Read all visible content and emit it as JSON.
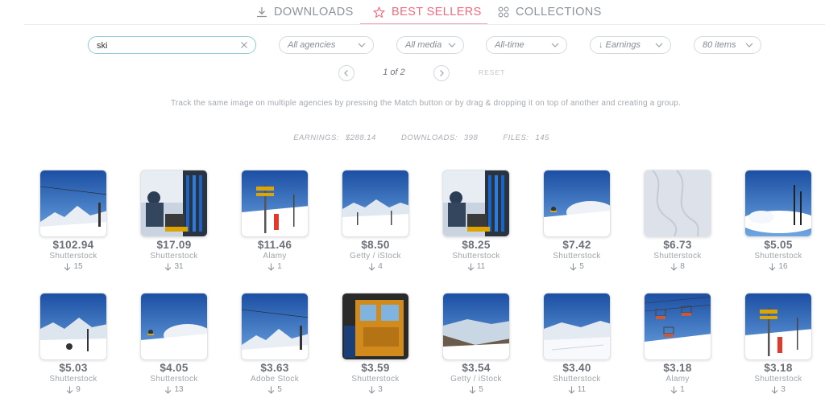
{
  "nav": {
    "tabs": [
      {
        "label": "DOWNLOADS",
        "icon": "download-icon"
      },
      {
        "label": "BEST SELLERS",
        "icon": "star-icon",
        "active": true
      },
      {
        "label": "COLLECTIONS",
        "icon": "grid-icon"
      }
    ],
    "accent_color": "#f06b7f"
  },
  "filters": {
    "search_value": "ski",
    "agencies": "All agencies",
    "media": "All media",
    "period": "All-time",
    "sort": "↓ Earnings",
    "items": "80 items"
  },
  "pagination": {
    "label": "1 of 2",
    "reset": "RESET"
  },
  "info_text": "Track the same image on multiple agencies by pressing the Match button or by drag & dropping it on top of another and creating a group.",
  "stats": {
    "earnings_label": "EARNINGS:",
    "earnings_value": "$288.14",
    "downloads_label": "DOWNLOADS:",
    "downloads_value": "398",
    "files_label": "FILES:",
    "files_value": "145"
  },
  "items": [
    {
      "price": "$102.94",
      "agency": "Shutterstock",
      "downloads": "15"
    },
    {
      "price": "$17.09",
      "agency": "Shutterstock",
      "downloads": "31"
    },
    {
      "price": "$11.46",
      "agency": "Alamy",
      "downloads": "1"
    },
    {
      "price": "$8.50",
      "agency": "Getty / iStock",
      "downloads": "4"
    },
    {
      "price": "$8.25",
      "agency": "Shutterstock",
      "downloads": "11"
    },
    {
      "price": "$7.42",
      "agency": "Shutterstock",
      "downloads": "5"
    },
    {
      "price": "$6.73",
      "agency": "Shutterstock",
      "downloads": "8"
    },
    {
      "price": "$5.05",
      "agency": "Shutterstock",
      "downloads": "16"
    },
    {
      "price": "$5.03",
      "agency": "Shutterstock",
      "downloads": "9"
    },
    {
      "price": "$4.05",
      "agency": "Shutterstock",
      "downloads": "13"
    },
    {
      "price": "$3.63",
      "agency": "Adobe Stock",
      "downloads": "5"
    },
    {
      "price": "$3.59",
      "agency": "Shutterstock",
      "downloads": "3"
    },
    {
      "price": "$3.54",
      "agency": "Getty / iStock",
      "downloads": "5"
    },
    {
      "price": "$3.40",
      "agency": "Shutterstock",
      "downloads": "11"
    },
    {
      "price": "$3.18",
      "agency": "Alamy",
      "downloads": "1"
    },
    {
      "price": "$3.18",
      "agency": "Shutterstock",
      "downloads": "3"
    }
  ]
}
